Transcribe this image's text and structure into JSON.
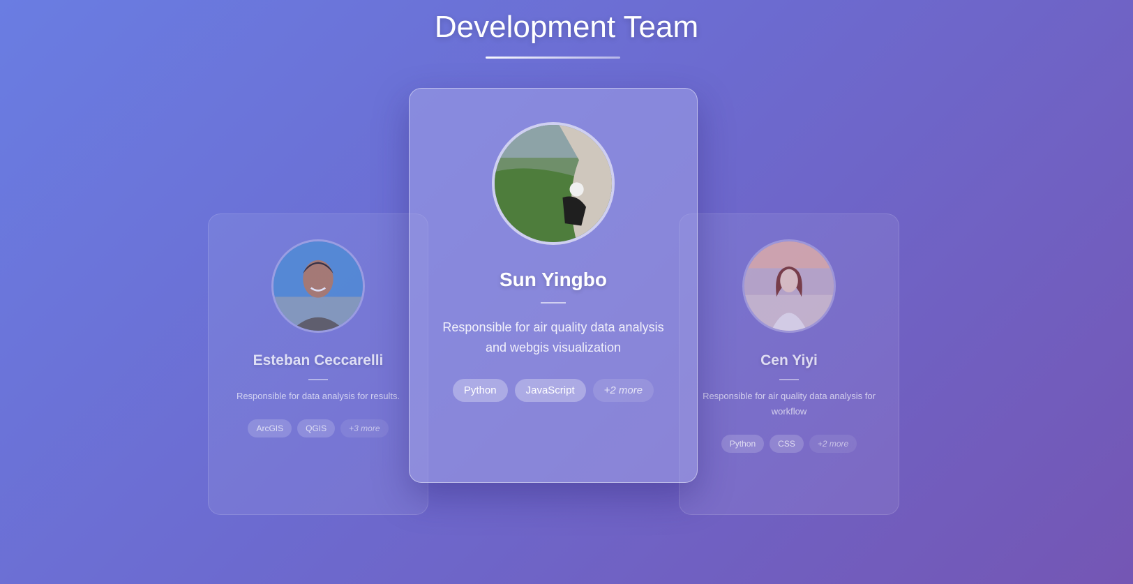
{
  "header": {
    "title": "Development Team"
  },
  "members": [
    {
      "name": "Esteban Ceccarelli",
      "description": "Responsible for data analysis for results.",
      "tags": [
        "ArcGIS",
        "QGIS"
      ],
      "more": "+3 more"
    },
    {
      "name": "Sun Yingbo",
      "description": "Responsible for air quality data analysis and webgis visualization",
      "tags": [
        "Python",
        "JavaScript"
      ],
      "more": "+2 more"
    },
    {
      "name": "Cen Yiyi",
      "description": "Responsible for air quality data analysis for workflow",
      "tags": [
        "Python",
        "CSS"
      ],
      "more": "+2 more"
    }
  ],
  "colors": {
    "background_start": "#6a7de2",
    "background_end": "#7456b4"
  }
}
